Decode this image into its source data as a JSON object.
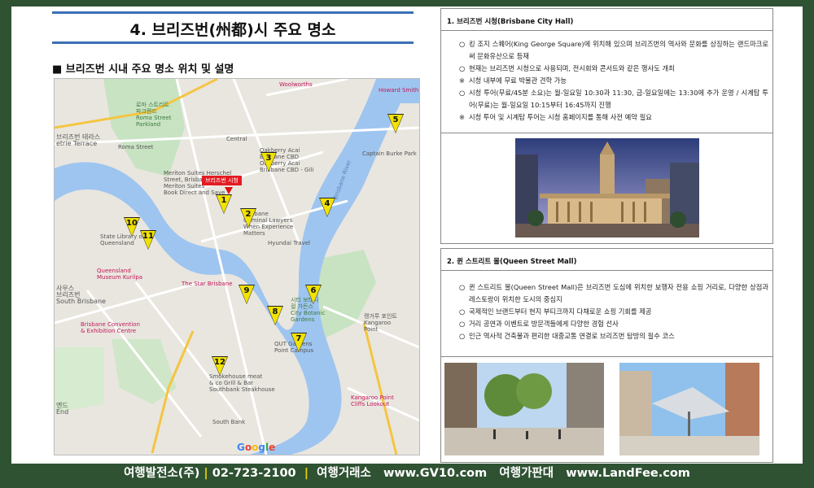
{
  "title": "4. 브리즈번(州都)시 주요 명소",
  "section_heading": "■ 브리즈번 시내 주요 명소 위치 및 설명",
  "map": {
    "callout": "브리즈번 시청",
    "google_logo": "Google",
    "markers": [
      "1",
      "2",
      "3",
      "4",
      "5",
      "6",
      "7",
      "8",
      "9",
      "10",
      "11",
      "12"
    ],
    "labels": {
      "woolworths": "Woolworths",
      "howard": "Howard Smith W",
      "roma_st_parkland": "로마 스트리트\n파크랜드\nRoma Street\nParkland",
      "terrace": "브리즈번 테라스\netrie Terrace",
      "roma_st_station": "Roma Street",
      "central": "Central",
      "oakberry": "Oakberry Acai\nBrisbane CBD\nOakberry Acai\nBrisbane CBD - Gili",
      "meriton": "Meriton Suites Herschel\nStreet, Brisbane\nMeriton Suites\nBook Direct and Save",
      "criminal": "Brisbane\nCriminal Lawyers\nWhen Experience\nMatters",
      "hyundai": "Hyundai Travel",
      "library": "State Library of\nQueensland",
      "qm": "Queensland\nMuseum Kurilpa",
      "star": "The Star Brisbane",
      "south_brisbane": "사우스\n브리즈번\nSouth Brisbane",
      "convention": "Brisbane Convention\n& Exhibition Centre",
      "botanic": "시티 보태니\n컬 가든스\nCity Botanic\nGardens",
      "qut": "QUT Gardens\nPoint Campus",
      "kangaroo": "캥거루 포인트\nKangaroo\nPoint",
      "smokehouse": "Smokehouse meat\n& co Grill & Bar\nSouthbank Steakhouse",
      "cliffs": "Kangaroo Point\nCliffs Lookout",
      "south_bank": "South Bank",
      "end": "엔드\nEnd",
      "story_bridge": "Captain Burke Park",
      "brisbane_river": "Brisbane River"
    }
  },
  "city_hall": {
    "heading": "1. 브리즈번 시청(Brisbane City Hall)",
    "bullets": [
      {
        "mark": "○",
        "text": "킹 조지 스퀘어(King George Square)에 위치해 있으며 브리즈번의 역사와 문화를 상징하는 랜드마크로써 문화유산으로 등재"
      },
      {
        "mark": "○",
        "text": "현재는 브리즈번 시청으로 사용되며, 전시회와 콘서트와 같은 행사도 개최"
      },
      {
        "mark": "※",
        "text": "시청 내부에 무료 박물관 견학 가능"
      },
      {
        "mark": "○",
        "text": "시청 투어(무료/45분 소요)는 월-일요일 10:30과 11:30, 금-일요일에는 13:30에 추가 운영 / 시계탑 투어(무료)는 월-일요일 10:15부터 16:45까지 진행"
      },
      {
        "mark": "※",
        "text": "시청 투어 및 시계탑 투어는 시청 홈페이지를 통해 사전 예약 필요"
      }
    ]
  },
  "queen_street": {
    "heading": "2. 퀸 스트리트 몰(Queen Street Mall)",
    "bullets": [
      {
        "mark": "○",
        "text": "퀸 스트리트 몰(Queen Street Mall)은 브리즈번 도심에 위치한 보행자 전용 쇼핑 거리로, 다양한 상점과 레스토랑이 위치한 도시의 중심지"
      },
      {
        "mark": "○",
        "text": "국제적인 브랜드부터 현지 부티크까지 다채로운 쇼핑 기회를 제공"
      },
      {
        "mark": "○",
        "text": "거리 공연과 이벤트로 방문객들에게 다양한 경험 선사"
      },
      {
        "mark": "○",
        "text": "인근 역사적 건축물과 편리한 대중교통 연결로 브리즈번 탐방의 필수 코스"
      }
    ]
  },
  "footer": {
    "company": "여행발전소(주)",
    "phone": "02-723-2100",
    "brand": "여행거래소",
    "site1": "www.GV10.com",
    "brand2": "여행가판대",
    "site2": "www.LandFee.com",
    "separator": "|"
  }
}
